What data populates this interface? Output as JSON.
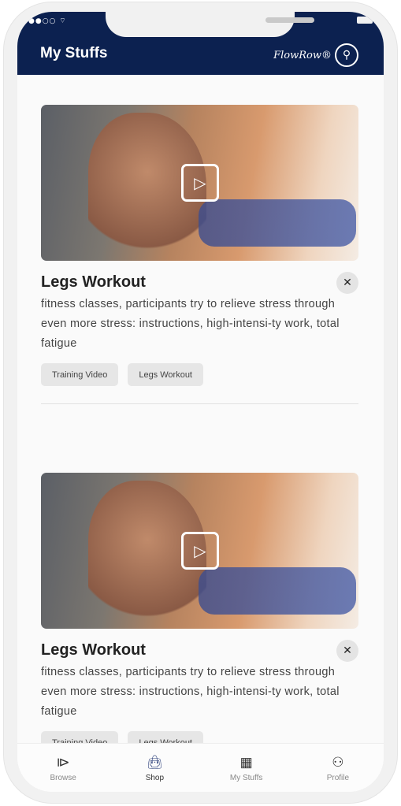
{
  "header": {
    "title": "My Stuffs",
    "logo_text": "FlowRow®",
    "status_dots": "●●○○",
    "wifi_icon": "wifi-icon"
  },
  "cards": [
    {
      "title": "Legs Workout",
      "description": "fitness classes, participants try to relieve stress through even more stress: instructions, high-intensi-ty work, total fatigue",
      "tags": [
        "Training Video",
        "Legs Workout"
      ]
    },
    {
      "title": "Legs Workout",
      "description": "fitness classes, participants try to relieve stress through even more stress: instructions, high-intensi-ty work, total fatigue",
      "tags": [
        "Training Video",
        "Legs Workout"
      ]
    }
  ],
  "nav": {
    "items": [
      {
        "label": "Browse",
        "icon": "play-square-icon"
      },
      {
        "label": "Shop",
        "icon": "shopping-bag-icon",
        "active": true
      },
      {
        "label": "My Stuffs",
        "icon": "dashboard-icon"
      },
      {
        "label": "Profile",
        "icon": "user-icon"
      }
    ]
  },
  "colors": {
    "header": "#0c2150",
    "background": "#fafafa"
  }
}
